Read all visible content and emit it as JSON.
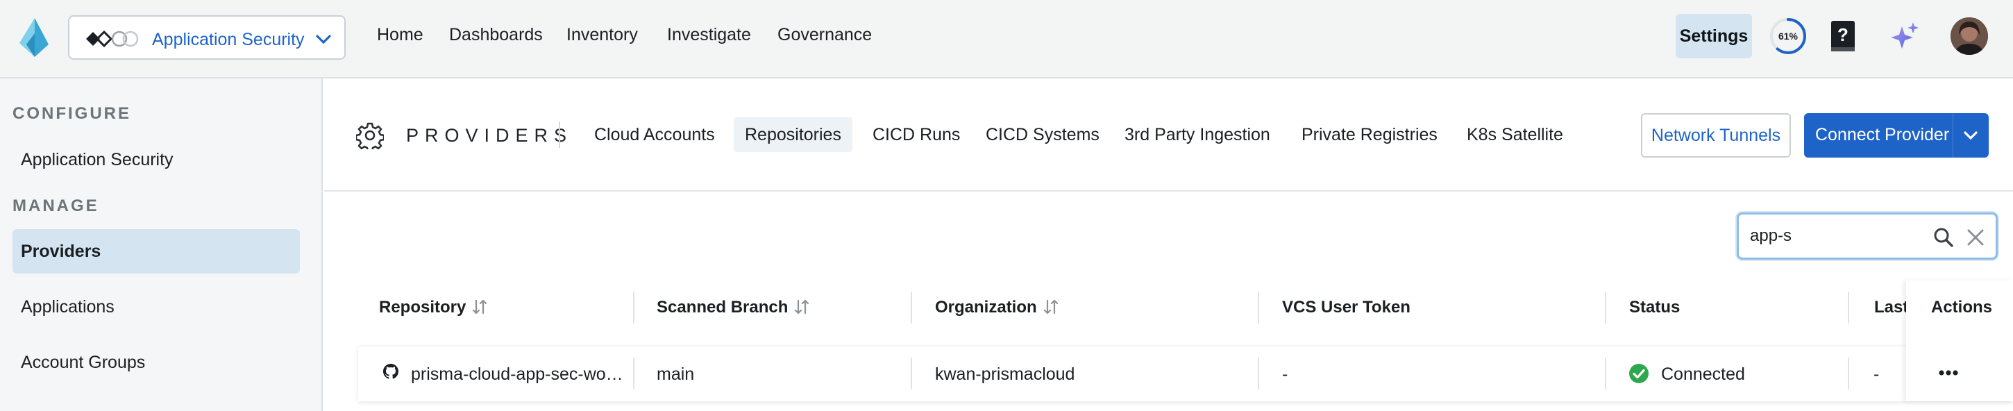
{
  "header": {
    "app_switcher": {
      "label": "Application Security"
    },
    "nav": [
      "Home",
      "Dashboards",
      "Inventory",
      "Investigate",
      "Governance"
    ],
    "settings_label": "Settings",
    "progress": {
      "value": 61,
      "label": "61%"
    }
  },
  "sidebar": {
    "configure_title": "CONFIGURE",
    "configure_items": [
      "Application Security"
    ],
    "manage_title": "MANAGE",
    "manage_items": [
      "Providers",
      "Applications",
      "Account Groups"
    ],
    "active_item": "Providers"
  },
  "providers": {
    "title": "PROVIDERS",
    "tabs": [
      "Cloud Accounts",
      "Repositories",
      "CICD Runs",
      "CICD Systems",
      "3rd Party Ingestion",
      "Private Registries",
      "K8s Satellite"
    ],
    "active_tab": "Repositories",
    "network_tunnels_label": "Network Tunnels",
    "connect_provider_label": "Connect Provider"
  },
  "search": {
    "value": "app-s"
  },
  "table": {
    "columns": [
      "Repository",
      "Scanned Branch",
      "Organization",
      "VCS User Token",
      "Status",
      "Last",
      "Actions"
    ],
    "rows": [
      {
        "repository": "prisma-cloud-app-sec-wo…",
        "branch": "main",
        "organization": "kwan-prismacloud",
        "token": "-",
        "status": "Connected",
        "last": "-"
      }
    ]
  },
  "colors": {
    "brand_blue": "#1e63c8",
    "active_bg": "#d4e5f1",
    "success_green": "#2ea84f",
    "logo_blue": "#57b8dc"
  }
}
